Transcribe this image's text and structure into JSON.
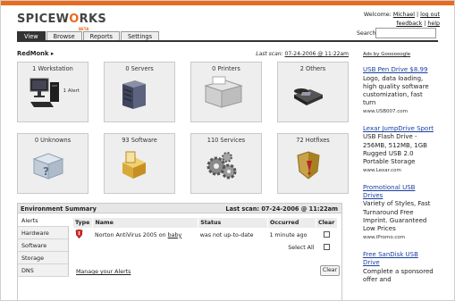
{
  "logo": {
    "text_a": "SPICEW",
    "text_o": "O",
    "text_b": "RKS",
    "beta": "BETA"
  },
  "user": {
    "welcome": "Welcome:",
    "name": "Michael",
    "logout": "log out",
    "feedback": "feedback",
    "help": "help"
  },
  "search": {
    "label": "Search:",
    "value": ""
  },
  "tabs": [
    "View",
    "Browse",
    "Reports",
    "Settings"
  ],
  "breadcrumb": "RedMonk",
  "last_scan": {
    "label": "Last scan:",
    "value": "07-24-2006 @ 11:22am"
  },
  "tiles": [
    {
      "label": "1 Workstation",
      "sub": "1 Alert",
      "icon": "workstation-icon"
    },
    {
      "label": "0 Servers",
      "sub": "",
      "icon": "server-icon"
    },
    {
      "label": "0 Printers",
      "sub": "",
      "icon": "printer-icon"
    },
    {
      "label": "2 Others",
      "sub": "",
      "icon": "phone-icon"
    },
    {
      "label": "0 Unknowns",
      "sub": "",
      "icon": "unknown-box-icon"
    },
    {
      "label": "93 Software",
      "sub": "",
      "icon": "software-icon"
    },
    {
      "label": "110 Services",
      "sub": "",
      "icon": "gears-icon"
    },
    {
      "label": "72 Hotfixes",
      "sub": "",
      "icon": "shield-icon"
    }
  ],
  "env": {
    "title": "Environment Summary",
    "last_scan": "Last scan: 07-24-2006 @ 11:22am",
    "sidebar": [
      "Alerts",
      "Hardware",
      "Software",
      "Storage",
      "DNS"
    ],
    "columns": [
      "Type",
      "Name",
      "Status",
      "Occurred",
      "Clear"
    ],
    "rows": [
      {
        "name_prefix": "Norton AntiVirus 2005 on ",
        "name_link": "baby",
        "status": "was not up-to-date",
        "occurred": "1 minute ago"
      }
    ],
    "select_all": "Select All",
    "manage_link": "Manage your Alerts",
    "clear_button": "Clear"
  },
  "ads": {
    "header": "Ads by Goooooogle",
    "items": [
      {
        "title": "USB Pen Drive $8.99",
        "body": "Logo, data loading, high quality software customization, fast turn",
        "url": "www.USB007.com"
      },
      {
        "title": "Lexar JumpDrive Sport",
        "body": "USB Flash Drive - 256MB, 512MB, 1GB Rugged USB 2.0 Portable Storage",
        "url": "www.Lexar.com"
      },
      {
        "title": "Promotional USB Drives",
        "body": "Variety of Styles, Fast Turnaround Free Imprint. Guaranteed Low Prices",
        "url": "www.iPromo.com"
      },
      {
        "title": "Free SanDisk USB Drive",
        "body": "Complete a sponsored offer and",
        "url": ""
      }
    ]
  }
}
